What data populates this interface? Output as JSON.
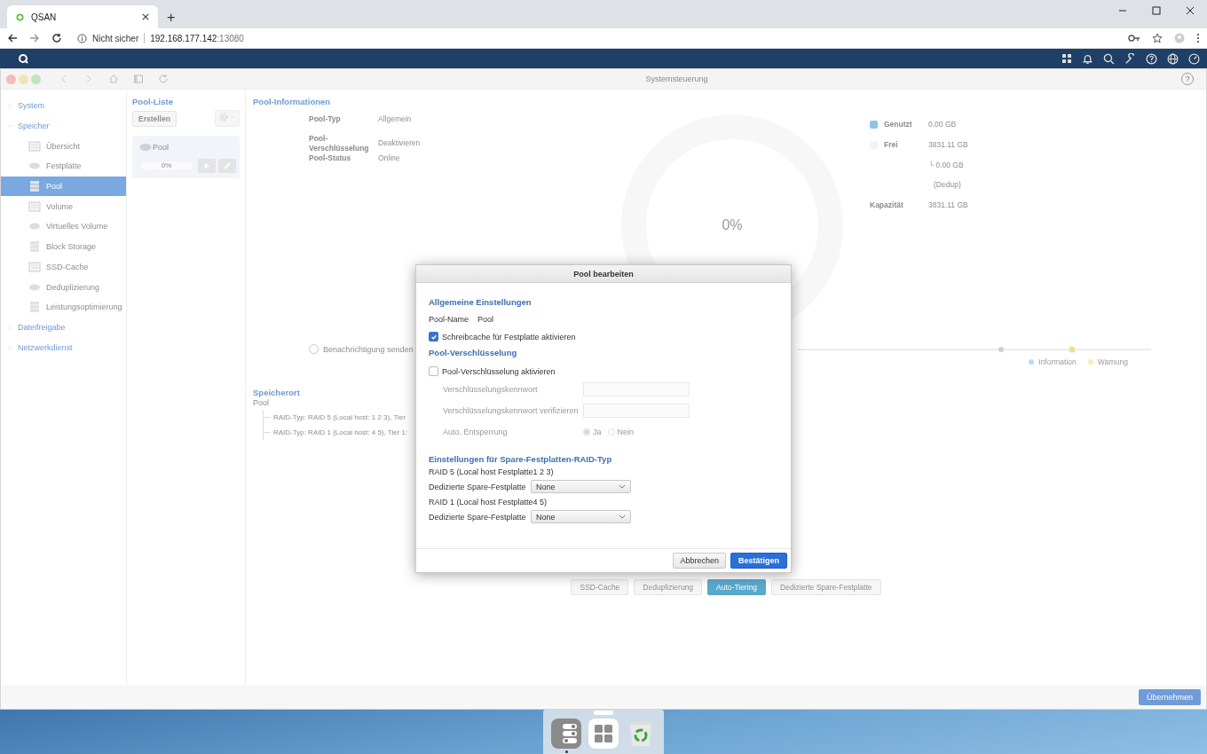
{
  "browser": {
    "tab_title": "QSAN",
    "new_tab": "+",
    "security": "Nicht sicher",
    "host": "192.168.177.142",
    "port": ":13080"
  },
  "window": {
    "title": "Systemsteuerung",
    "help": "?"
  },
  "sidebar": {
    "items": [
      {
        "label": "System",
        "expanded": false
      },
      {
        "label": "Speicher",
        "expanded": true,
        "children": [
          {
            "label": "Übersicht",
            "selected": false
          },
          {
            "label": "Festplatte",
            "selected": false
          },
          {
            "label": "Pool",
            "selected": true
          },
          {
            "label": "Volume",
            "selected": false
          },
          {
            "label": "Virtuelles Volume",
            "selected": false
          },
          {
            "label": "Block Storage",
            "selected": false
          },
          {
            "label": "SSD-Cache",
            "selected": false
          },
          {
            "label": "Deduplizierung",
            "selected": false
          },
          {
            "label": "Leistungsoptimierung",
            "selected": false
          }
        ]
      },
      {
        "label": "Dateifreigabe",
        "expanded": false
      },
      {
        "label": "Netzwerkdienst",
        "expanded": false
      }
    ]
  },
  "pool_list": {
    "title": "Pool-Liste",
    "create_button": "Erstellen",
    "pools": [
      {
        "name": "Pool",
        "selected": true,
        "level": 0,
        "reading": "0%"
      }
    ]
  },
  "pool_info": {
    "title": "Pool-Informationen",
    "fields": [
      {
        "label": "Pool-Typ",
        "value": "Allgemein"
      },
      {
        "label": "Pool-Verschlüsselung",
        "value": "Deaktivieren"
      },
      {
        "label": "Pool-Status",
        "value": "Online"
      }
    ],
    "usage_center": "0%",
    "legend": [
      {
        "label": "Genutzt",
        "value": "0.00 GB",
        "color": "#8cc4e6"
      },
      {
        "label": "Frei",
        "value": "3831.11 GB",
        "color": "#f2f2f2"
      }
    ],
    "dedup_value": "└ 0.00 GB",
    "dedup_label": "(Dedup)",
    "capacity": {
      "label": "Kapazität",
      "value": "3831.11 GB"
    }
  },
  "notification": {
    "label": "Benachrichtigung senden",
    "checked": false
  },
  "timeline_legend": [
    {
      "label": "Information",
      "color": "#b9d9ef"
    },
    {
      "label": "Warnung",
      "color": "#f3ecb5"
    }
  ],
  "location": {
    "title": "Speicherort",
    "pool": "Pool",
    "raid_lines": [
      "RAID-Typ: RAID 5 (Local host: 1 2 3), Tier",
      "RAID-Typ: RAID 1 (Local host: 4 5), Tier 1:"
    ]
  },
  "tabs": [
    {
      "label": "SSD-Cache",
      "selected": false
    },
    {
      "label": "Deduplizierung",
      "selected": false
    },
    {
      "label": "Auto-Tiering",
      "selected": true
    },
    {
      "label": "Dedizierte Spare-Festplatte",
      "selected": false
    }
  ],
  "apply_button": "Übernehmen",
  "dialog": {
    "title": "Pool bearbeiten",
    "general_title": "Allgemeine Einstellungen",
    "name_label": "Pool-Name",
    "name_value": "Pool",
    "write_cache": {
      "label": "Schreibcache für Festplatte aktivieren",
      "checked": true
    },
    "encryption_title": "Pool-Verschlüsselung",
    "encryption": {
      "label": "Pool-Verschlüsselung aktivieren",
      "checked": false
    },
    "password_fields": [
      {
        "label": "Verschlüsselungskennwort",
        "disabled": true
      },
      {
        "label": "Verschlüsselungskennwort verifizieren",
        "disabled": true
      }
    ],
    "auto_unlock": {
      "label": "Auto. Entsperrung",
      "disabled": true,
      "options": [
        {
          "label": "Ja",
          "selected": true
        },
        {
          "label": "Nein",
          "selected": false
        }
      ]
    },
    "spare_title": "Einstellungen für Spare-Festplatten-RAID-Typ",
    "spare_groups": [
      {
        "raid": "RAID 5 (Local host Festplatte1 2 3)",
        "label": "Dedizierte Spare-Festplatte",
        "value": "None"
      },
      {
        "raid": "RAID 1 (Local host Festplatte4 5)",
        "label": "Dedizierte Spare-Festplatte",
        "value": "None"
      }
    ],
    "cancel_button": "Abbrechen",
    "confirm_button": "Bestätigen"
  }
}
